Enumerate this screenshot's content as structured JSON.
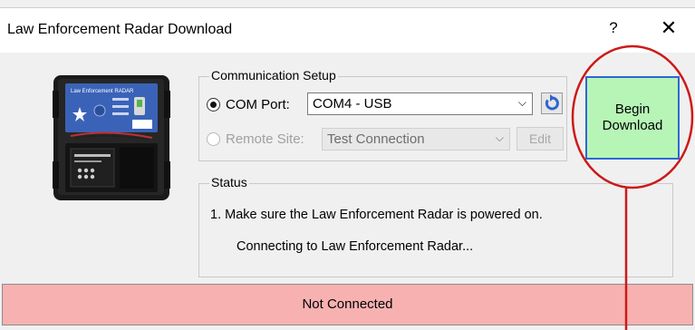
{
  "window": {
    "title": "Law Enforcement Radar Download",
    "help_label": "?",
    "close_label": "✕"
  },
  "device_image": {
    "label": "Law Enforcement RADAR",
    "icon": "radar-device-image"
  },
  "communication": {
    "group_label": "Communication Setup",
    "com_port_label": "COM Port:",
    "com_port_selected": true,
    "com_port_value": "COM4 - USB",
    "remote_site_label": "Remote Site:",
    "remote_site_selected": false,
    "remote_site_value": "Test Connection",
    "edit_label": "Edit",
    "refresh_icon": "refresh-icon"
  },
  "begin_download": {
    "line1": "Begin",
    "line2": "Download",
    "background": "#b6f5b6",
    "border": "#2d67d6"
  },
  "status": {
    "group_label": "Status",
    "line1": "1. Make sure the Law Enforcement Radar is powered on.",
    "line2": "Connecting to Law Enforcement Radar..."
  },
  "connection_bar": {
    "text": "Not Connected",
    "background": "#f8b1b1"
  },
  "annotation": {
    "color": "#cc1a1a"
  }
}
